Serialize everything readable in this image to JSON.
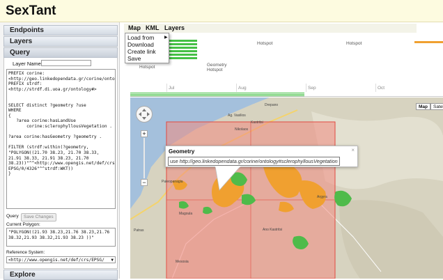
{
  "app": {
    "title": "SexTant"
  },
  "sidebar": {
    "sections": [
      {
        "label": "Endpoints"
      },
      {
        "label": "Layers"
      },
      {
        "label": "Query"
      },
      {
        "label": "Explore"
      }
    ],
    "query": {
      "layer_name_label": "Layer Name:",
      "layer_name_value": "",
      "sparql": "PREFIX corine:\n<http://geo.linkedopendata.gr/corine/ontology#>\nPREFIX strdf:\n<http://strdf.di.uoa.gr/ontology#>\n\n\nSELECT distinct ?geometry ?use\nWHERE\n{\n   ?area corine:hasLandUse\n       corine:sclerophyllousVegetation .\n\n?area corine:hasGeometry ?geometry .\n\nFILTER (strdf:within(?geometry,\n\"POLYGON((21.70 38.23, 21.70 38.33,\n21.91 38.33, 21.91 38.23, 21.70\n38.23))\"^^<http://www.opengis.net/def/crs/\nEPSG/0/4326\"^^strdf:WKT))\n}",
      "query_button": "Query",
      "save_button": "Save Changes",
      "current_polygon_label": "Current Polygon:",
      "current_polygon": "\"POLYGON((21.93 38.23,21.76 38.23,21.76\n38.32,21.93 38.32,21.93 38.23 ))\"",
      "ref_system_label": "Reference System:",
      "ref_system": "<http://www.opengis.net/def/crs/EPSG/"
    }
  },
  "menubar": {
    "items": [
      "Map",
      "KML",
      "Layers"
    ],
    "map_menu": [
      "Load from",
      "Download",
      "Create link",
      "Save"
    ]
  },
  "timeline": {
    "labels": [
      "Hotspot",
      "Hotspot",
      "Hotspot",
      "Geometry",
      "Hotspot"
    ],
    "months": [
      "Jul",
      "Aug",
      "Sep",
      "Oct"
    ],
    "accent_green": "#45c045",
    "accent_orange": "#f0a030"
  },
  "map": {
    "type_buttons": [
      "Map",
      "Satel"
    ],
    "places": [
      "Ag. Vasilios",
      "Kastritsi",
      "Nikolaos",
      "Ano Kastritsi",
      "Drepano",
      "Argyra",
      "Magoula",
      "Paleopanagia",
      "Mesosia",
      "Patras"
    ],
    "popup": {
      "title": "Geometry",
      "prefix": "use",
      "uri": "http://geo.linkedopendata.gr/corine/ontology#sclerophyllousVegetation",
      "close": "×"
    }
  }
}
